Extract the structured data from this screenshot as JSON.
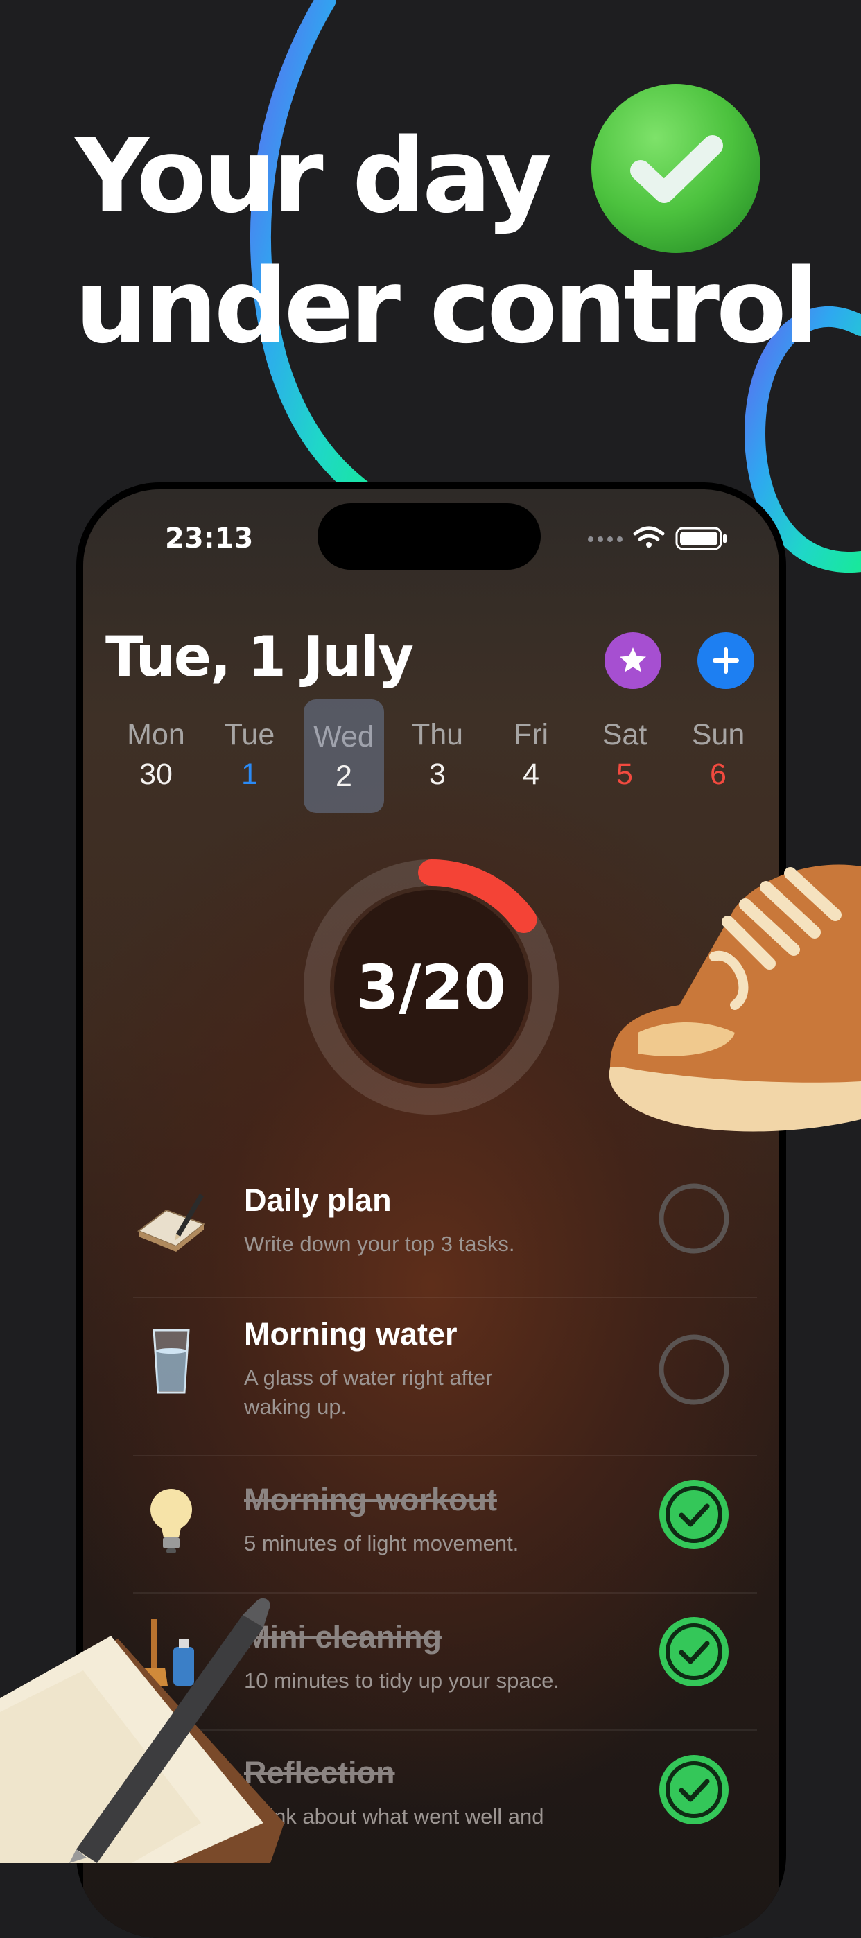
{
  "headline": {
    "line1": "Your day",
    "line2": "under control"
  },
  "colors": {
    "background": "#1e1e20",
    "accent_blue": "#1d7ff2",
    "accent_purple": "#a64fd1",
    "ring_progress": "#f44336",
    "check_green": "#34c759",
    "weekend_red": "#f24a3f"
  },
  "status_bar": {
    "time": "23:13",
    "icons": [
      "signal-dots-icon",
      "wifi-icon",
      "battery-icon"
    ]
  },
  "header": {
    "date": "Tue, 1 July",
    "star_icon": "star-icon",
    "add_icon": "plus-icon"
  },
  "week": [
    {
      "name": "Mon",
      "num": "30"
    },
    {
      "name": "Tue",
      "num": "1"
    },
    {
      "name": "Wed",
      "num": "2"
    },
    {
      "name": "Thu",
      "num": "3"
    },
    {
      "name": "Fri",
      "num": "4"
    },
    {
      "name": "Sat",
      "num": "5"
    },
    {
      "name": "Sun",
      "num": "6"
    }
  ],
  "progress": {
    "label": "3/20",
    "done": 3,
    "total": 20
  },
  "tasks": [
    {
      "title": "Daily plan",
      "desc": "Write down your top 3 tasks.",
      "icon": "notepad-icon",
      "done": false
    },
    {
      "title": "Morning water",
      "desc": "A glass of water right after waking up.",
      "icon": "water-glass-icon",
      "done": false
    },
    {
      "title": "Morning workout",
      "desc": "5 minutes of light movement.",
      "icon": "light-bulb-icon",
      "done": true
    },
    {
      "title": "Mini cleaning",
      "desc": "10 minutes to tidy up your space.",
      "icon": "cleaning-icon",
      "done": true
    },
    {
      "title": "Reflection",
      "desc": "Think about what went well and",
      "icon": "reflection-icon",
      "done": true
    }
  ]
}
